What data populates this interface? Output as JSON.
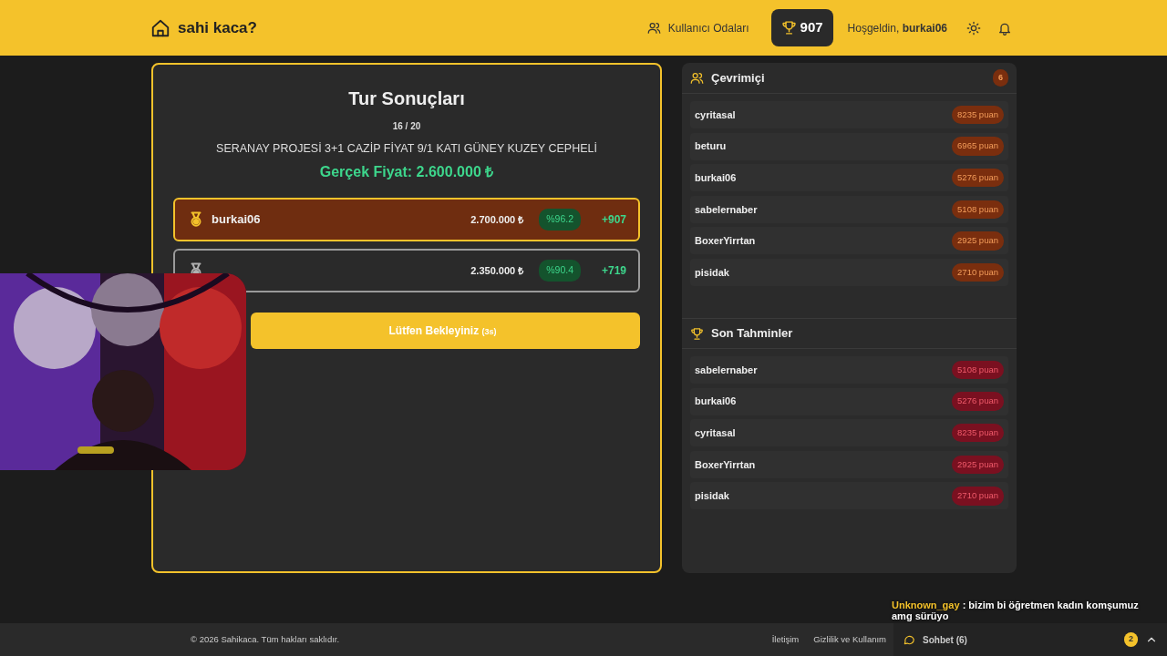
{
  "header": {
    "brand": "sahi kaca?",
    "nav_link": "Kullanıcı Odaları",
    "score": "907",
    "greeting_prefix": "Hoşgeldin,",
    "greeting_user": "burkai06"
  },
  "round": {
    "title": "Tur Sonuçları",
    "progress": "16 / 20",
    "listing": "SERANAY PROJESİ 3+1 CAZİP FİYAT 9/1 KATI GÜNEY KUZEY CEPHELİ",
    "real_price": "Gerçek Fiyat: 2.600.000 ₺",
    "results": [
      {
        "name": "burkai06",
        "guess": "2.700.000 ₺",
        "accuracy": "%96.2",
        "points": "+907",
        "highlighted": true,
        "color": "#f4c22b"
      },
      {
        "guess": "2.350.000 ₺",
        "accuracy": "%90.4",
        "points": "+719",
        "highlighted": false,
        "color": "#b0b0b0"
      }
    ],
    "wait_button": {
      "label": "Lütfen Bekleyiniz",
      "countdown": "(3s)"
    }
  },
  "online": {
    "title": "Çevrimiçi",
    "count": "6",
    "users": [
      {
        "name": "cyritasal",
        "points": "8235 puan"
      },
      {
        "name": "beturu",
        "points": "6965 puan"
      },
      {
        "name": "burkai06",
        "points": "5276 puan"
      },
      {
        "name": "sabelernaber",
        "points": "5108 puan"
      },
      {
        "name": "BoxerYirrtan",
        "points": "2925 puan"
      },
      {
        "name": "pisidak",
        "points": "2710 puan"
      }
    ]
  },
  "recent": {
    "title": "Son Tahminler",
    "guesses": [
      {
        "name": "sabelernaber",
        "points": "5108 puan"
      },
      {
        "name": "burkai06",
        "points": "5276 puan"
      },
      {
        "name": "cyritasal",
        "points": "8235 puan"
      },
      {
        "name": "BoxerYirrtan",
        "points": "2925 puan"
      },
      {
        "name": "pisidak",
        "points": "2710 puan"
      }
    ]
  },
  "footer": {
    "copyright": "© 2026 Sahikaca. Tüm hakları saklıdır.",
    "links": [
      "İletişim",
      "Gizlilik ve Kullanım"
    ],
    "chat": {
      "label": "Sohbet (6)",
      "unread": "2"
    }
  },
  "overlay_chat": {
    "user": "Unknown_gay",
    "message": ": bizim bi öğretmen kadın komşumuz amg sürüyo"
  }
}
